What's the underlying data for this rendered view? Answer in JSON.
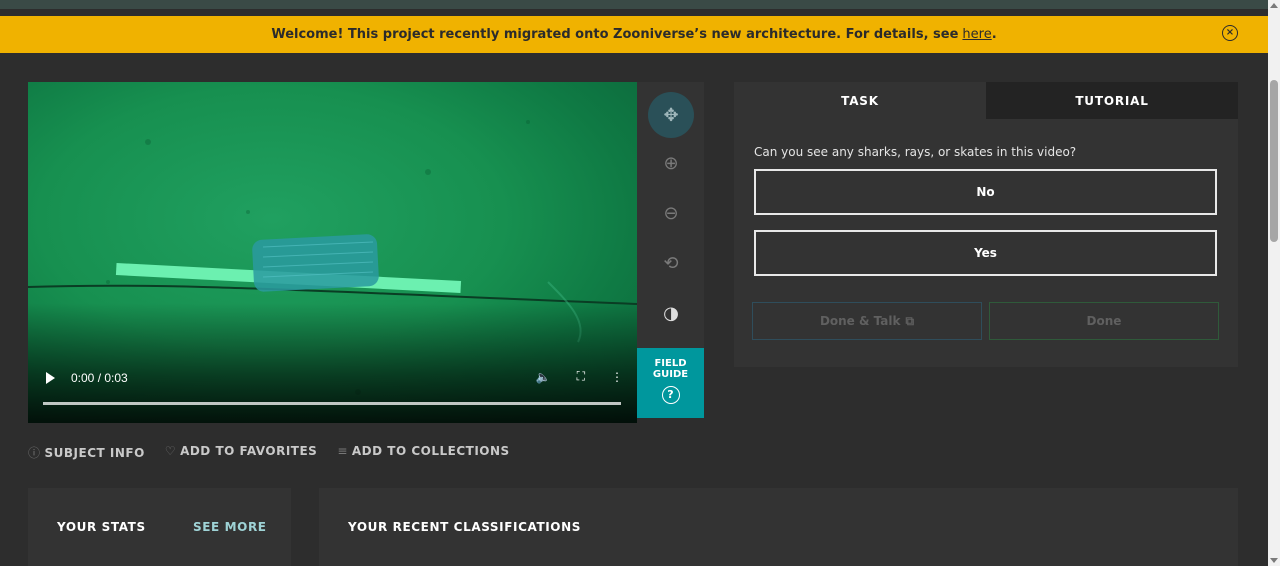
{
  "banner": {
    "text": "Welcome! This project recently migrated onto Zooniverse’s new architecture. For details, see",
    "link": "here",
    "suffix": ".",
    "close_icon": "close-circle-icon"
  },
  "video": {
    "time": "0:00 / 0:03",
    "icons": [
      "play-icon",
      "volume-icon",
      "fullscreen-icon",
      "more-vertical-icon"
    ]
  },
  "toolbar": {
    "tools": [
      "move-icon",
      "zoom-in-icon",
      "zoom-out-icon",
      "rotate-icon",
      "invert-icon"
    ],
    "field_guide": "FIELD GUIDE"
  },
  "subject_links": {
    "info": "SUBJECT INFO",
    "favorites": "ADD TO FAVORITES",
    "collections": "ADD TO COLLECTIONS"
  },
  "task": {
    "tabs": [
      "TASK",
      "TUTORIAL"
    ],
    "question": "Can you see any sharks, rays, or skates in this video?",
    "answers": [
      "No",
      "Yes"
    ],
    "done_talk": "Done & Talk",
    "done": "Done"
  },
  "stats": {
    "title": "YOUR STATS",
    "see_more": "SEE MORE"
  },
  "recent": {
    "title": "YOUR RECENT CLASSIFICATIONS"
  }
}
